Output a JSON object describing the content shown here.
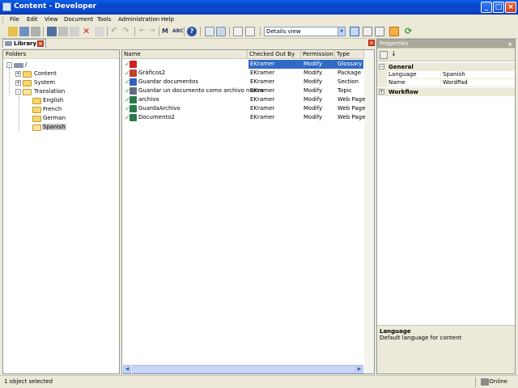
{
  "window": {
    "title": "Content - Developer"
  },
  "menu": [
    "File",
    "Edit",
    "View",
    "Document",
    "Tools",
    "Administration",
    "Help"
  ],
  "toolbar": {
    "view_select": "Details view"
  },
  "library_tab": {
    "label": "Library"
  },
  "folders": {
    "header": "Folders",
    "tree": [
      {
        "label": "/",
        "expander": "-"
      },
      {
        "label": "Content",
        "expander": "+"
      },
      {
        "label": "System",
        "expander": "+"
      },
      {
        "label": "Translation",
        "expander": "-"
      },
      {
        "label": "English"
      },
      {
        "label": "French"
      },
      {
        "label": "German"
      },
      {
        "label": "Spanish",
        "selected": true
      }
    ]
  },
  "list": {
    "columns": [
      "Name",
      "Checked Out By",
      "Permission",
      "Type"
    ],
    "rows": [
      {
        "name": "WordPad",
        "checked_out_by": "EKramer",
        "permission": "Modify",
        "type": "Glossary",
        "selected": true,
        "icon_color": "#d02020"
      },
      {
        "name": "Gráficos2",
        "checked_out_by": "EKramer",
        "permission": "Modify",
        "type": "Package",
        "icon_color": "#c04030"
      },
      {
        "name": "Guardar documentos",
        "checked_out_by": "EKramer",
        "permission": "Modify",
        "type": "Section",
        "icon_color": "#3060c0"
      },
      {
        "name": "Guardar un documento como archivo nuevo",
        "checked_out_by": "EKramer",
        "permission": "Modify",
        "type": "Topic",
        "icon_color": "#607080"
      },
      {
        "name": "archivo",
        "checked_out_by": "EKramer",
        "permission": "Modify",
        "type": "Web Page",
        "icon_color": "#2a7a4a"
      },
      {
        "name": "GuardaArchivo",
        "checked_out_by": "EKramer",
        "permission": "Modify",
        "type": "Web Page",
        "icon_color": "#2a7a4a"
      },
      {
        "name": "Documento2",
        "checked_out_by": "EKramer",
        "permission": "Modify",
        "type": "Web Page",
        "icon_color": "#2a7a4a"
      }
    ]
  },
  "properties": {
    "title": "Properties",
    "category": "General",
    "rows": [
      {
        "key": "Language",
        "value": "Spanish"
      },
      {
        "key": "Name",
        "value": "WordPad"
      }
    ],
    "category2": "Workflow",
    "description_title": "Language",
    "description_text": "Default language for content"
  },
  "status": {
    "left": "1 object selected",
    "right": "Online"
  },
  "colors": {
    "selection": "#316ac5",
    "titlebar": "#0a49d0",
    "check": "#2a9a2a"
  }
}
